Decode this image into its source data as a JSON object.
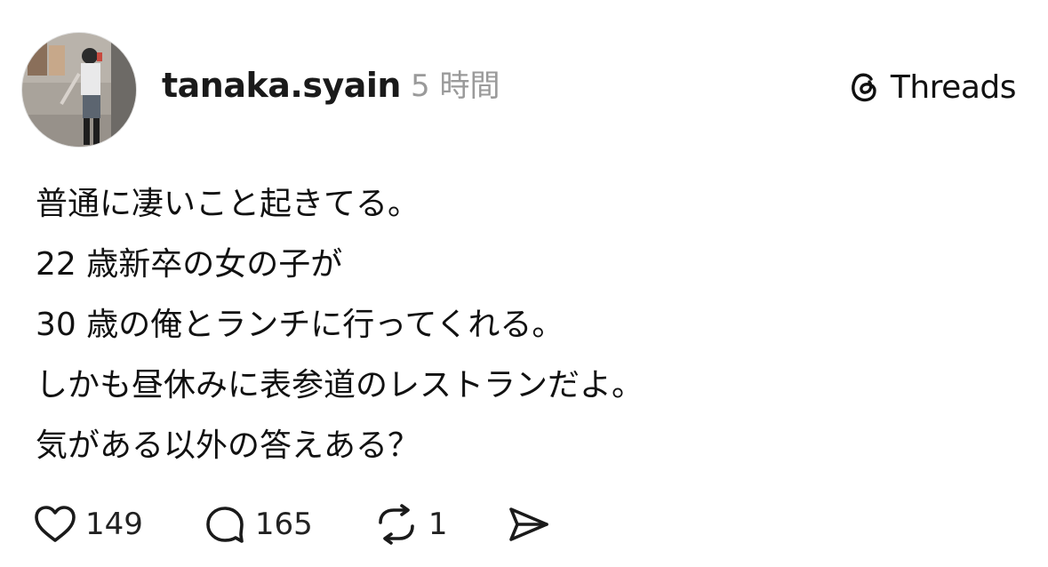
{
  "post": {
    "author": {
      "username": "tanaka.syain",
      "timestamp": "5 時間"
    },
    "brand": {
      "icon": "threads-logo-icon",
      "name": "Threads"
    },
    "text_lines": [
      "普通に凄いこと起きてる。",
      "22 歳新卒の女の子が",
      "30 歳の俺とランチに行ってくれる。",
      "しかも昼休みに表参道のレストランだよ。",
      "気がある以外の答えある？"
    ],
    "actions": {
      "like": {
        "icon": "heart-icon",
        "count": "149"
      },
      "reply": {
        "icon": "comment-bubble-icon",
        "count": "165"
      },
      "repost": {
        "icon": "repost-icon",
        "count": "1"
      },
      "share": {
        "icon": "send-icon"
      }
    }
  }
}
